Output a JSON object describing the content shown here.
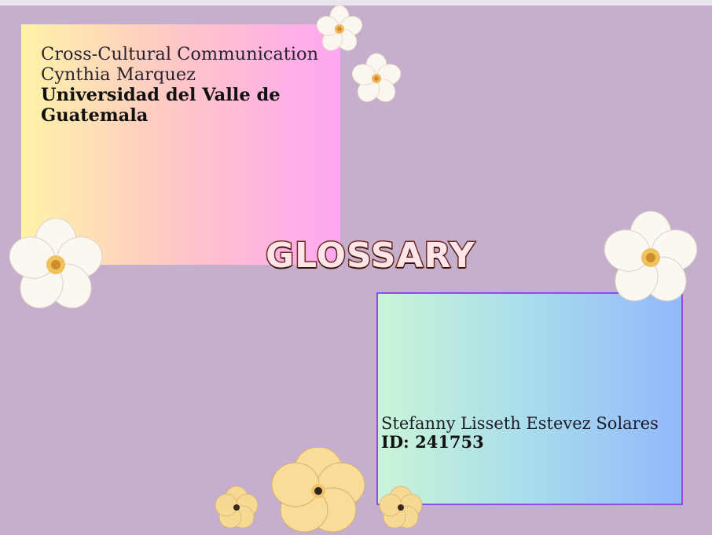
{
  "slide": {
    "title": "GLOSSARY",
    "course": "Cross-Cultural Communication",
    "teacher": "Cynthia Marquez",
    "university": "Universidad del Valle de Guatemala",
    "student_name": "Stefanny Lisseth Estevez Solares",
    "student_id": "ID: 241753"
  },
  "colors": {
    "background": "#c6aecd",
    "top_card_gradient": [
      "#fff3a8",
      "#ffc7c6",
      "#ffa6f2"
    ],
    "bottom_card_gradient": [
      "#c9f5d7",
      "#a9dcec",
      "#93b8fb"
    ],
    "bottom_card_border": "#8b4fe1",
    "title_fill": "#fde5ea",
    "title_outline": "#6e2d1e"
  },
  "decorations": [
    "white-flower-icon",
    "yellow-flower-icon"
  ]
}
